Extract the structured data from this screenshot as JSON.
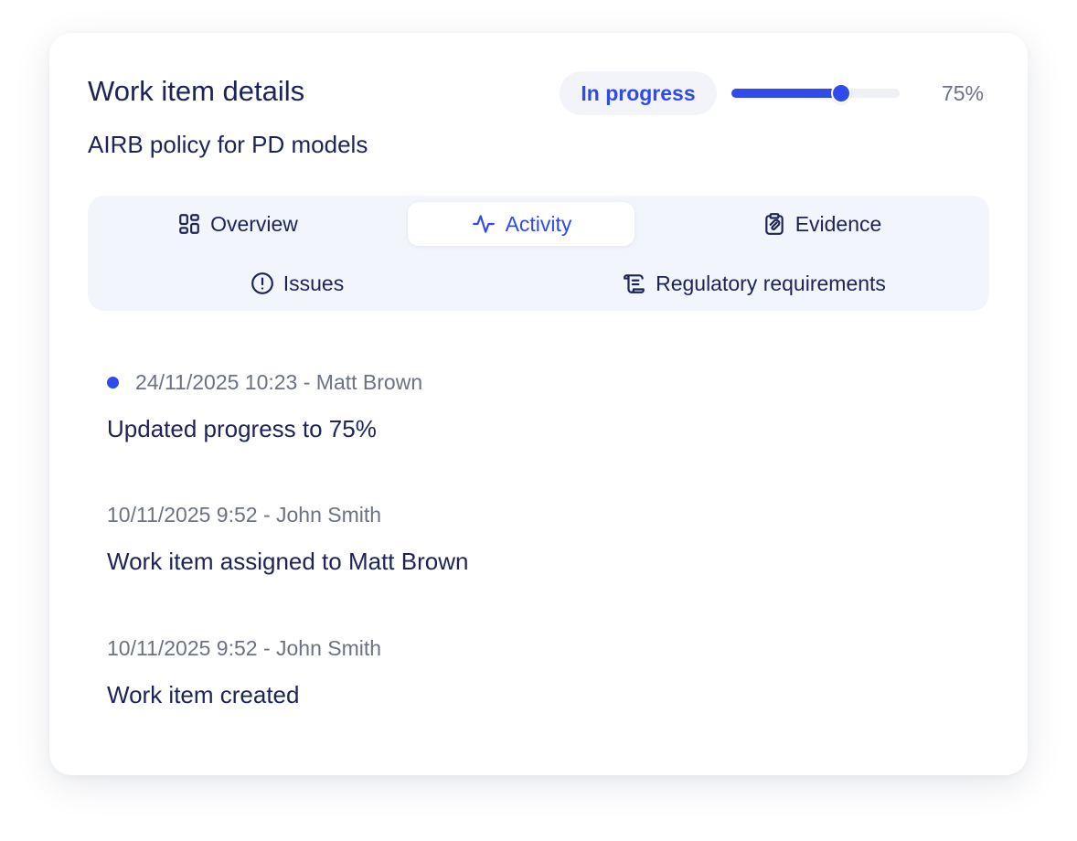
{
  "header": {
    "title": "Work item details",
    "subtitle": "AIRB policy for PD models",
    "status": "In progress",
    "progress_value": 0.65,
    "progress_label": "75%"
  },
  "tabs": [
    {
      "label": "Overview",
      "icon": "grid-icon"
    },
    {
      "label": "Activity",
      "icon": "activity-pulse-icon",
      "active": true
    },
    {
      "label": "Evidence",
      "icon": "clipboard-attachment-icon"
    },
    {
      "label": "Issues",
      "icon": "alert-circle-icon"
    },
    {
      "label": "Regulatory requirements",
      "icon": "scroll-icon"
    }
  ],
  "activity": [
    {
      "meta": "24/11/2025 10:23 - Matt Brown",
      "text": "Updated progress to 75%",
      "latest": true
    },
    {
      "meta": "10/11/2025 9:52 - John Smith",
      "text": "Work item assigned to Matt Brown"
    },
    {
      "meta": "10/11/2025 9:52 - John Smith",
      "text": "Work item created"
    }
  ],
  "colors": {
    "accent": "#2f4bec",
    "text": "#1c2357",
    "muted": "#6b7282",
    "tab_bg": "#f2f5fc"
  }
}
